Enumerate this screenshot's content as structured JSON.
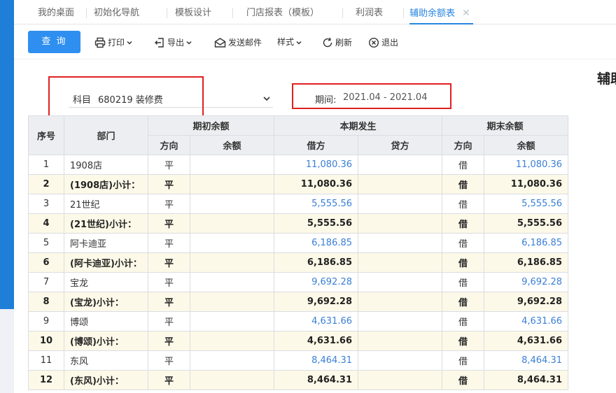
{
  "tabs": [
    {
      "label": "我的桌面",
      "active": false
    },
    {
      "label": "初始化导航",
      "active": false
    },
    {
      "label": "模板设计",
      "active": false
    },
    {
      "label": "门店报表（模板）",
      "active": false
    },
    {
      "label": "利润表",
      "active": false
    },
    {
      "label": "辅助余额表",
      "active": true,
      "closable": true
    }
  ],
  "toolbar": {
    "query": "查 询",
    "print": "打印",
    "export": "导出",
    "email": "发送邮件",
    "style": "样式",
    "refresh": "刷新",
    "exit": "退出"
  },
  "report_title": "辅助",
  "filter": {
    "subject_label": "科目",
    "subject_value": "680219 装修费",
    "period_label": "期间:",
    "period_value": "2021.04 - 2021.04"
  },
  "table": {
    "headers": {
      "seq": "序号",
      "dept": "部门",
      "opening": "期初余额",
      "current": "本期发生",
      "closing": "期末余额",
      "direction": "方向",
      "balance": "余额",
      "debit": "借方",
      "credit": "贷方"
    },
    "rows": [
      {
        "seq": "1",
        "dept": "1908店",
        "open_dir": "平",
        "open_bal": "",
        "debit": "11,080.36",
        "credit": "",
        "close_dir": "借",
        "close_bal": "11,080.36",
        "subtotal": false
      },
      {
        "seq": "2",
        "dept": "(1908店)小计：",
        "open_dir": "平",
        "open_bal": "",
        "debit": "11,080.36",
        "credit": "",
        "close_dir": "借",
        "close_bal": "11,080.36",
        "subtotal": true
      },
      {
        "seq": "3",
        "dept": "21世纪",
        "open_dir": "平",
        "open_bal": "",
        "debit": "5,555.56",
        "credit": "",
        "close_dir": "借",
        "close_bal": "5,555.56",
        "subtotal": false
      },
      {
        "seq": "4",
        "dept": "(21世纪)小计：",
        "open_dir": "平",
        "open_bal": "",
        "debit": "5,555.56",
        "credit": "",
        "close_dir": "借",
        "close_bal": "5,555.56",
        "subtotal": true
      },
      {
        "seq": "5",
        "dept": "阿卡迪亚",
        "open_dir": "平",
        "open_bal": "",
        "debit": "6,186.85",
        "credit": "",
        "close_dir": "借",
        "close_bal": "6,186.85",
        "subtotal": false
      },
      {
        "seq": "6",
        "dept": "(阿卡迪亚)小计：",
        "open_dir": "平",
        "open_bal": "",
        "debit": "6,186.85",
        "credit": "",
        "close_dir": "借",
        "close_bal": "6,186.85",
        "subtotal": true
      },
      {
        "seq": "7",
        "dept": "宝龙",
        "open_dir": "平",
        "open_bal": "",
        "debit": "9,692.28",
        "credit": "",
        "close_dir": "借",
        "close_bal": "9,692.28",
        "subtotal": false
      },
      {
        "seq": "8",
        "dept": "(宝龙)小计：",
        "open_dir": "平",
        "open_bal": "",
        "debit": "9,692.28",
        "credit": "",
        "close_dir": "借",
        "close_bal": "9,692.28",
        "subtotal": true
      },
      {
        "seq": "9",
        "dept": "博颂",
        "open_dir": "平",
        "open_bal": "",
        "debit": "4,631.66",
        "credit": "",
        "close_dir": "借",
        "close_bal": "4,631.66",
        "subtotal": false
      },
      {
        "seq": "10",
        "dept": "(博颂)小计：",
        "open_dir": "平",
        "open_bal": "",
        "debit": "4,631.66",
        "credit": "",
        "close_dir": "借",
        "close_bal": "4,631.66",
        "subtotal": true
      },
      {
        "seq": "11",
        "dept": "东风",
        "open_dir": "平",
        "open_bal": "",
        "debit": "8,464.31",
        "credit": "",
        "close_dir": "借",
        "close_bal": "8,464.31",
        "subtotal": false
      },
      {
        "seq": "12",
        "dept": "(东风)小计：",
        "open_dir": "平",
        "open_bal": "",
        "debit": "8,464.31",
        "credit": "",
        "close_dir": "借",
        "close_bal": "8,464.31",
        "subtotal": true
      }
    ]
  },
  "colors": {
    "accent": "#2e8ff0",
    "active_tab": "#2a86e0",
    "amount_blue": "#3a7fd5",
    "subtotal_bg": "#fdf9e8",
    "highlight_box": "#e02020"
  }
}
